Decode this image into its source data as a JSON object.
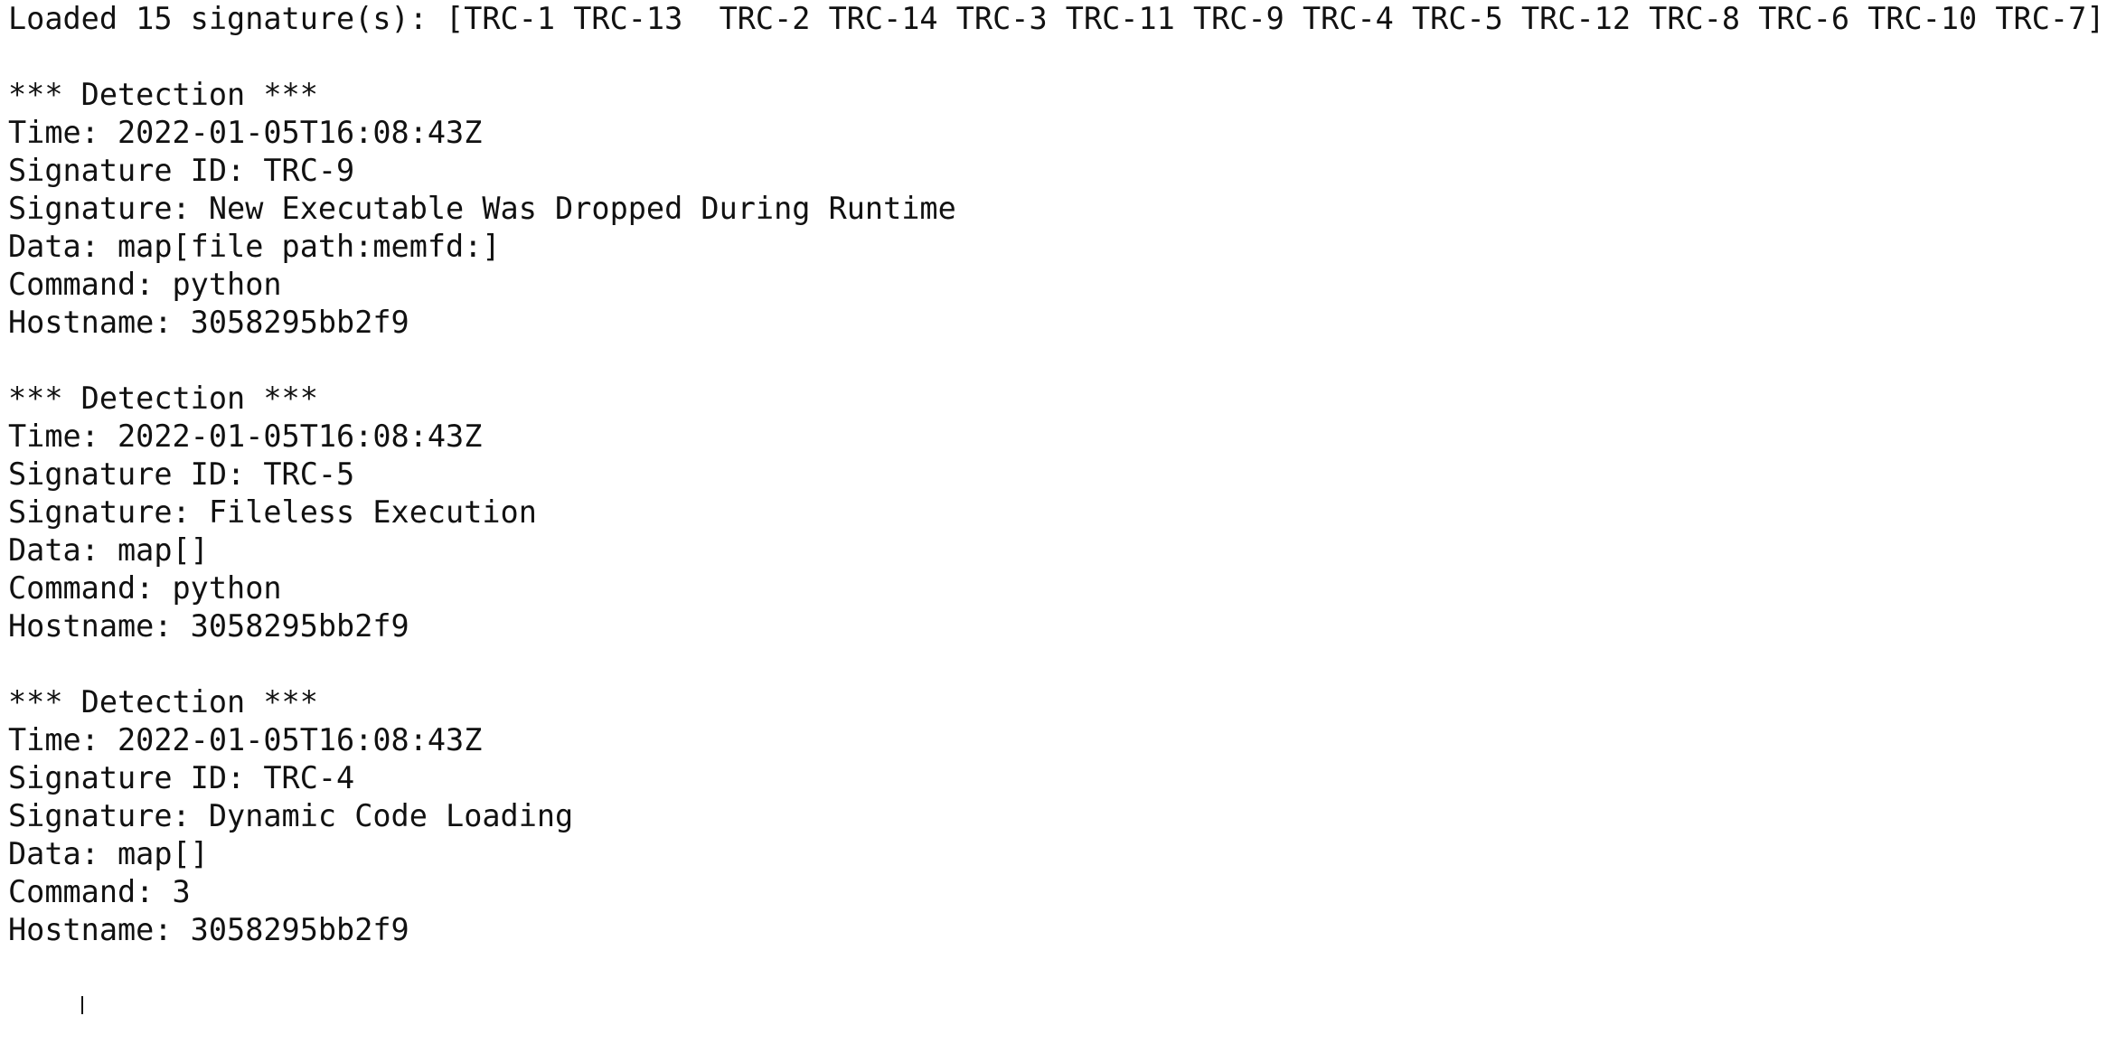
{
  "terminal": {
    "loaded_line": "Loaded 15 signature(s): [TRC-1 TRC-13  TRC-2 TRC-14 TRC-3 TRC-11 TRC-9 TRC-4 TRC-5 TRC-12 TRC-8 TRC-6 TRC-10 TRC-7]",
    "detections": [
      {
        "header": "*** Detection ***",
        "time": "Time: 2022-01-05T16:08:43Z",
        "signature_id": "Signature ID: TRC-9",
        "signature": "Signature: New Executable Was Dropped During Runtime",
        "data": "Data: map[file path:memfd:]",
        "command": "Command: python",
        "hostname": "Hostname: 3058295bb2f9"
      },
      {
        "header": "*** Detection ***",
        "time": "Time: 2022-01-05T16:08:43Z",
        "signature_id": "Signature ID: TRC-5",
        "signature": "Signature: Fileless Execution",
        "data": "Data: map[]",
        "command": "Command: python",
        "hostname": "Hostname: 3058295bb2f9"
      },
      {
        "header": "*** Detection ***",
        "time": "Time: 2022-01-05T16:08:43Z",
        "signature_id": "Signature ID: TRC-4",
        "signature": "Signature: Dynamic Code Loading",
        "data": "Data: map[]",
        "command": "Command: 3",
        "hostname": "Hostname: 3058295bb2f9"
      }
    ]
  }
}
